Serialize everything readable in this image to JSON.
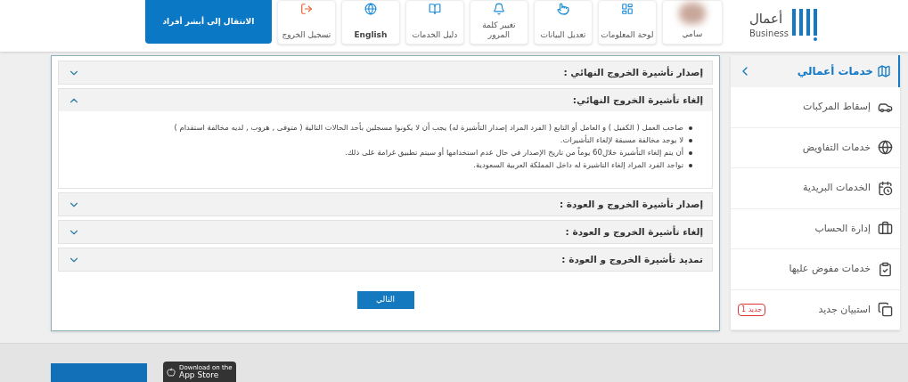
{
  "header": {
    "logo": {
      "arabic": "أعمال",
      "latin": "Business"
    },
    "user": {
      "name": "سامي"
    },
    "nav": [
      {
        "label": "لوحة المعلومات"
      },
      {
        "label": "تعديل البيانات"
      },
      {
        "label": "تغيير كلمة المرور"
      },
      {
        "label": "دليل الخدمات"
      },
      {
        "label": "English"
      },
      {
        "label": "تسجيل الخروج"
      }
    ],
    "switch_button": "الانتقال إلى أبشر أفراد"
  },
  "sidebar": {
    "title": "خدمات أعمالي",
    "expanded": true,
    "items": [
      {
        "label": "إسقاط المركبات"
      },
      {
        "label": "خدمات التفاويض"
      },
      {
        "label": "الخدمات البريدية"
      },
      {
        "label": "إدارة الحساب"
      },
      {
        "label": "خدمات مفوض عليها"
      },
      {
        "label": "استبيان جديد",
        "badge": "جديد 1"
      }
    ]
  },
  "accordion": [
    {
      "title": "إصدار تأشيرة الخروج النهائي :",
      "expanded": false
    },
    {
      "title": "إلغاء تأشيرة الخروج النهائي:",
      "expanded": true,
      "bullets": [
        "صاحب العمل ( الكفيل ) و العامل أو التابع ( الفرد المراد إصدار التأشيرة له) يجب أن لا يكونوا مسجلين بأحد الحالات التالية ( متوفى , هروب , لديه مخالفة استقدام )",
        "لا يوجد مخالفة مسبقة لإلغاء التأشيرات.",
        "أن يتم إلغاء التأشيرة خلال60 يوماً من تاريخ الإصدار في حال عدم استخدامها أو سيتم تطبيق غرامة على ذلك.",
        "تواجد الفرد المراد إلغاء التاشيرة له داخل المملكة العربية السعودية."
      ]
    },
    {
      "title": "إصدار تأشيرة الخروج و العودة :",
      "expanded": false
    },
    {
      "title": "إلغاء تأشيرة الخروج و العودة :",
      "expanded": false
    },
    {
      "title": "تمديد تأشيرة الخروج و العودة :",
      "expanded": false
    }
  ],
  "next_button": "التالي",
  "footer": {
    "app_store": {
      "line1": "Download on the",
      "line2": "App Store"
    }
  }
}
